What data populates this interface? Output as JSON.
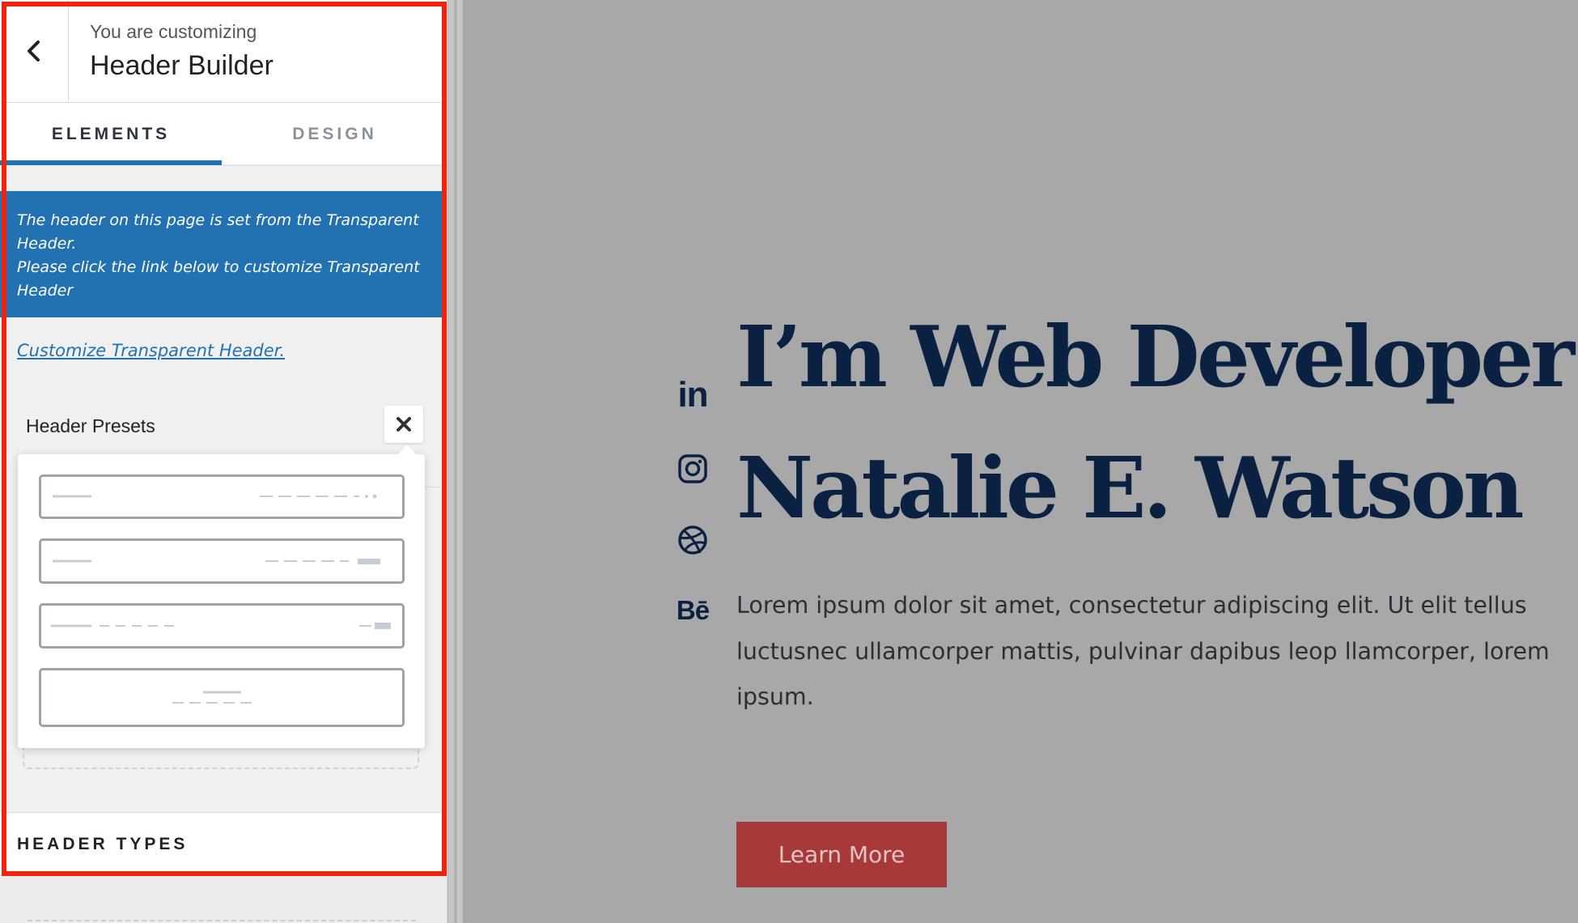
{
  "customizer": {
    "header": {
      "subtitle": "You are customizing",
      "title": "Header Builder"
    },
    "tabs": [
      {
        "label": "ELEMENTS",
        "active": true
      },
      {
        "label": "DESIGN",
        "active": false
      }
    ],
    "notice": {
      "line1": "The header on this page is set from the Transparent Header.",
      "line2": "Please click the link below to customize Transparent Header"
    },
    "link": "Customize Transparent Header.",
    "presets": {
      "label": "Header Presets"
    },
    "header_types": "HEADER TYPES"
  },
  "preview": {
    "social": [
      "linkedin-icon",
      "instagram-icon",
      "dribbble-icon",
      "behance-icon"
    ],
    "social_text": {
      "linkedin": "in",
      "behance": "Bē"
    },
    "title_line1": "I’m Web Developer",
    "title_line2": "Natalie E. Watson",
    "description": "Lorem ipsum dolor sit amet, consectetur adipiscing elit. Ut elit tellus luctusnec ullamcorper mattis, pulvinar dapibus leop llamcorper, lorem ipsum.",
    "button": "Learn More"
  },
  "colors": {
    "accent": "#2271b1",
    "highlight": "#f0240d",
    "title": "#0b2142",
    "button": "#a7393a",
    "preview_bg": "#a9a8a9"
  }
}
